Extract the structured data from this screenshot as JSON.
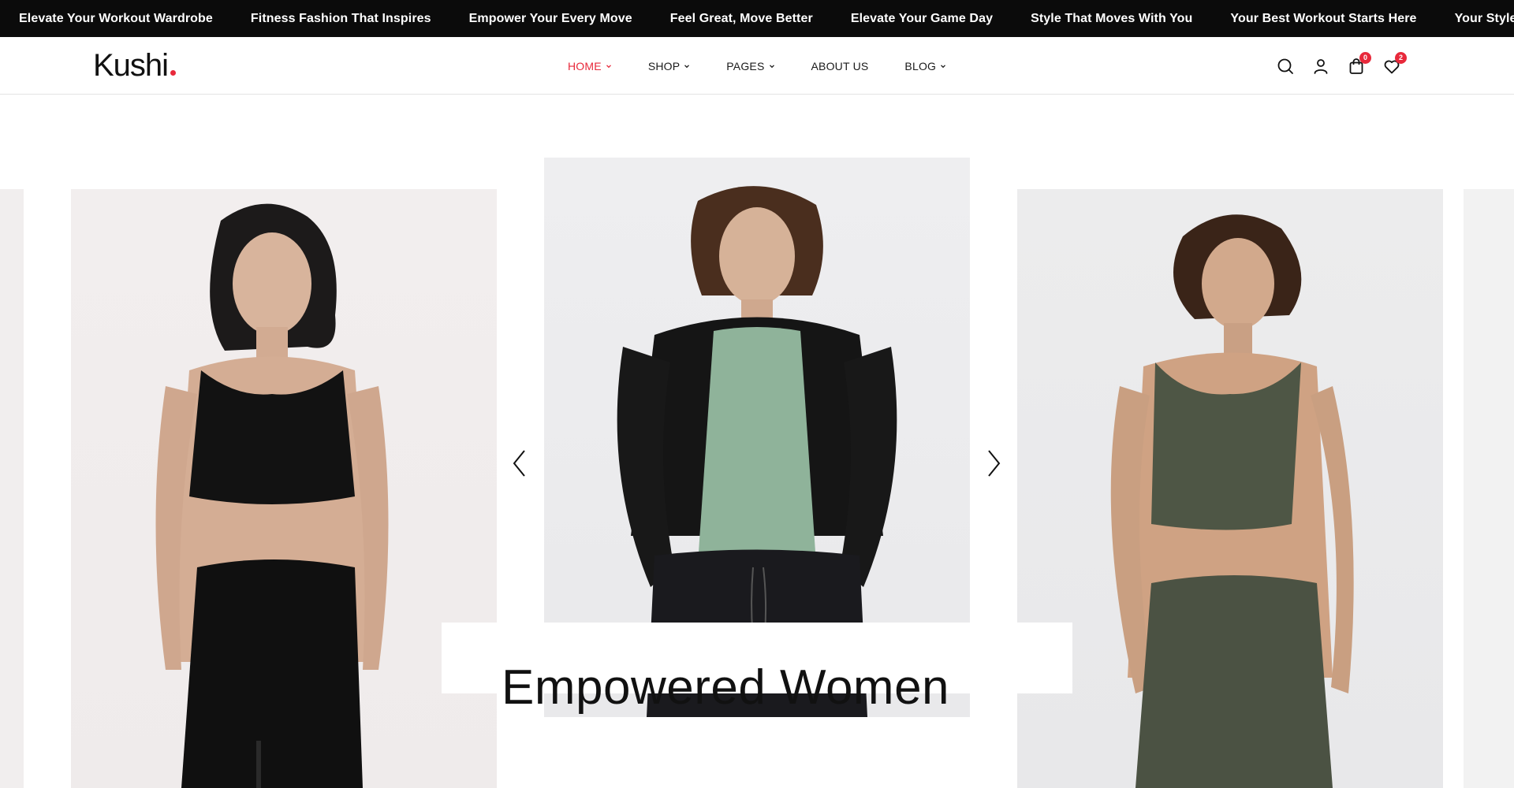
{
  "announcements": [
    "Elevate Your Workout Wardrobe",
    "Fitness Fashion That Inspires",
    "Empower Your Every Move",
    "Feel Great, Move Better",
    "Elevate Your Game Day",
    "Style That Moves With You",
    "Your Best Workout Starts Here",
    "Your Style, Your Workout"
  ],
  "header": {
    "logo": "Kushi",
    "nav": [
      {
        "label": "HOME",
        "dropdown": true,
        "active": true
      },
      {
        "label": "SHOP",
        "dropdown": true,
        "active": false
      },
      {
        "label": "PAGES",
        "dropdown": true,
        "active": false
      },
      {
        "label": "ABOUT US",
        "dropdown": false,
        "active": false
      },
      {
        "label": "BLOG",
        "dropdown": true,
        "active": false
      }
    ],
    "icons": [
      {
        "name": "search-icon"
      },
      {
        "name": "user-icon"
      },
      {
        "name": "cart-icon",
        "badge": "0"
      },
      {
        "name": "wishlist-heart-icon",
        "badge": "2"
      }
    ]
  },
  "hero": {
    "caption": "Empowered Women",
    "prev_icon": "chevron-left-icon",
    "next_icon": "chevron-right-icon"
  },
  "colors": {
    "accent": "#e8293b",
    "topbar": "#0b0b0b",
    "text": "#111111"
  }
}
